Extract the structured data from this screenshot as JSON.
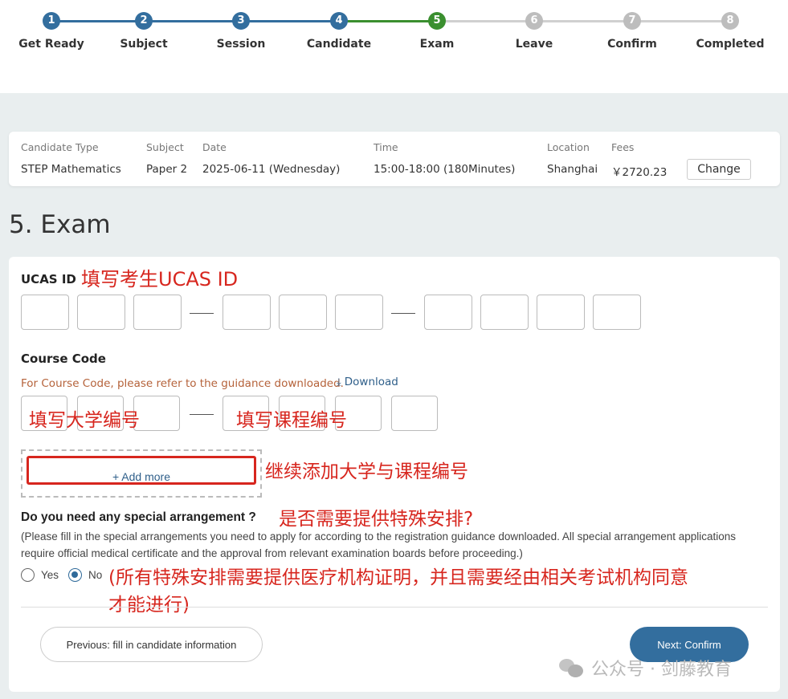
{
  "stepper": {
    "steps": [
      {
        "num": "1",
        "label": "Get Ready",
        "state": "done"
      },
      {
        "num": "2",
        "label": "Subject",
        "state": "done"
      },
      {
        "num": "3",
        "label": "Session",
        "state": "done"
      },
      {
        "num": "4",
        "label": "Candidate",
        "state": "done"
      },
      {
        "num": "5",
        "label": "Exam",
        "state": "current"
      },
      {
        "num": "6",
        "label": "Leave",
        "state": "todo"
      },
      {
        "num": "7",
        "label": "Confirm",
        "state": "todo"
      },
      {
        "num": "8",
        "label": "Completed",
        "state": "todo"
      }
    ],
    "colors": {
      "done": "#336e9e",
      "current": "#3a8f2f",
      "todo": "#bdbdbd"
    }
  },
  "summary": {
    "candidate_type": {
      "label": "Candidate Type",
      "value": "STEP Mathematics"
    },
    "subject": {
      "label": "Subject",
      "value": "Paper 2"
    },
    "date": {
      "label": "Date",
      "value": "2025-06-11 (Wednesday)"
    },
    "time": {
      "label": "Time",
      "value": "15:00-18:00 (180Minutes)"
    },
    "location": {
      "label": "Location",
      "value": "Shanghai"
    },
    "fees": {
      "label": "Fees",
      "value": "￥2720.23"
    },
    "change_label": "Change"
  },
  "page_title": "5. Exam",
  "form": {
    "ucas": {
      "label": "UCAS ID",
      "annotation": "填写考生UCAS ID",
      "dash": "—"
    },
    "course": {
      "label": "Course Code",
      "hint": "For Course Code, please refer to the guidance downloaded.",
      "download_label": "Download",
      "annotation_university": "填写大学编号",
      "annotation_course": "填写课程编号"
    },
    "add_more": {
      "label": "+ Add more",
      "annotation": "继续添加大学与课程编号"
    },
    "special": {
      "question": "Do you need any special arrangement ?",
      "annotation": "是否需要提供特殊安排?",
      "description": "(Please fill in the special arrangements you need to apply for according to the registration guidance downloaded. All special arrangement applications require official medical certificate and the approval from relevant examination boards before proceeding.)",
      "options": [
        {
          "label": "Yes",
          "selected": false
        },
        {
          "label": "No",
          "selected": true
        }
      ],
      "annotation_note_line1": "(所有特殊安排需要提供医疗机构证明，并且需要经由相关考试机构同意",
      "annotation_note_line2": "才能进行)"
    },
    "prev_label": "Previous: fill in candidate information",
    "next_label": "Next: Confirm"
  },
  "watermark": "公众号 · 剑藤教育"
}
